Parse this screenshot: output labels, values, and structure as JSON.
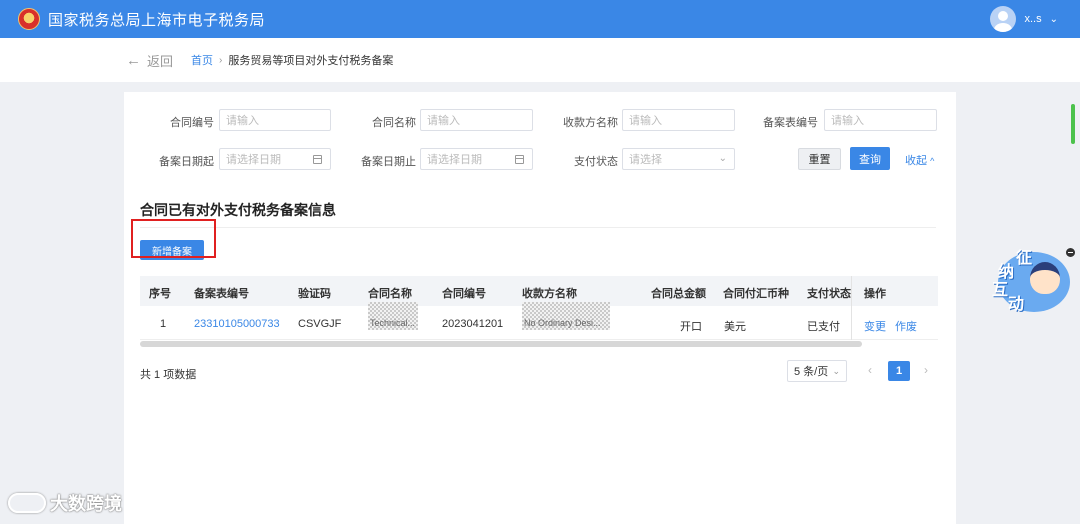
{
  "header": {
    "title": "国家税务总局上海市电子税务局",
    "user_name": "x..s"
  },
  "breadcrumb": {
    "back": "返回",
    "home": "首页",
    "current": "服务贸易等项目对外支付税务备案"
  },
  "filters": {
    "contract_no": {
      "label": "合同编号",
      "placeholder": "请输入"
    },
    "contract_name": {
      "label": "合同名称",
      "placeholder": "请输入"
    },
    "payee_name": {
      "label": "收款方名称",
      "placeholder": "请输入"
    },
    "record_no": {
      "label": "备案表编号",
      "placeholder": "请输入"
    },
    "date_from": {
      "label": "备案日期起",
      "placeholder": "请选择日期"
    },
    "date_to": {
      "label": "备案日期止",
      "placeholder": "请选择日期"
    },
    "pay_status": {
      "label": "支付状态",
      "placeholder": "请选择"
    },
    "reset_label": "重置",
    "search_label": "查询",
    "collapse_label": "收起"
  },
  "section": {
    "title": "合同已有对外支付税务备案信息",
    "add_button": "新增备案"
  },
  "table": {
    "columns": [
      "序号",
      "备案表编号",
      "验证码",
      "合同名称",
      "合同编号",
      "收款方名称",
      "合同总金额",
      "合同付汇币种",
      "支付状态",
      "操作"
    ],
    "rows": [
      {
        "index": "1",
        "record_no": "23310105000733",
        "verify_code": "CSVGJF",
        "contract_name": "Technical...",
        "contract_no": "2023041201",
        "payee_name": "No Ordinary Desi...",
        "amount": "开口",
        "currency": "美元",
        "status": "已支付",
        "action_change": "变更",
        "action_void": "作废"
      }
    ]
  },
  "pagination": {
    "total_text": "共 1 项数据",
    "page_size": "5 条/页",
    "current_page": "1"
  },
  "widget": {
    "chars": [
      "征",
      "纳",
      "互",
      "动"
    ]
  },
  "watermark": {
    "text": "大数跨境"
  }
}
